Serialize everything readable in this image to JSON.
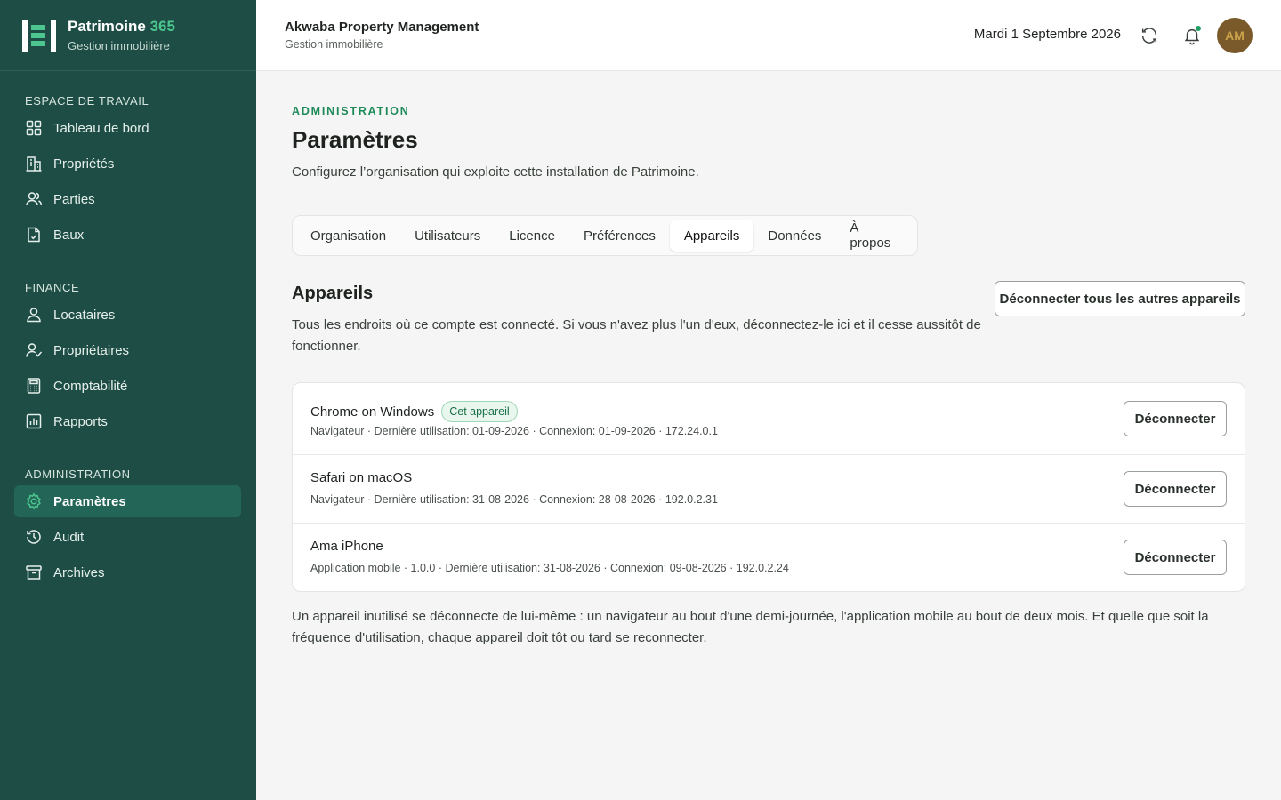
{
  "brand": {
    "name": "Patrimoine",
    "name_accent": "365",
    "subtitle": "Gestion immobilière"
  },
  "sidebar": {
    "sections": [
      {
        "heading": "ESPACE DE TRAVAIL",
        "items": [
          {
            "label": "Tableau de bord",
            "icon": "grid-icon"
          },
          {
            "label": "Propriétés",
            "icon": "building-icon"
          },
          {
            "label": "Parties",
            "icon": "users-icon"
          },
          {
            "label": "Baux",
            "icon": "document-icon"
          }
        ]
      },
      {
        "heading": "FINANCE",
        "items": [
          {
            "label": "Locataires",
            "icon": "user-group-icon"
          },
          {
            "label": "Propriétaires",
            "icon": "user-check-icon"
          },
          {
            "label": "Comptabilité",
            "icon": "calculator-icon"
          },
          {
            "label": "Rapports",
            "icon": "chart-icon"
          }
        ]
      },
      {
        "heading": "ADMINISTRATION",
        "items": [
          {
            "label": "Paramètres",
            "icon": "gear-icon",
            "active": true
          },
          {
            "label": "Audit",
            "icon": "history-icon"
          },
          {
            "label": "Archives",
            "icon": "archive-icon"
          }
        ]
      }
    ]
  },
  "header": {
    "org_name": "Akwaba Property Management",
    "org_subtitle": "Gestion immobilière",
    "date": "Mardi 1 Septembre 2026",
    "avatar_initials": "AM"
  },
  "page": {
    "eyebrow": "ADMINISTRATION",
    "title": "Paramètres",
    "description": "Configurez l’organisation qui exploite cette installation de Patrimoine.",
    "tabs": [
      "Organisation",
      "Utilisateurs",
      "Licence",
      "Préférences",
      "Appareils",
      "Données",
      "À propos"
    ],
    "active_tab": "Appareils"
  },
  "devices_section": {
    "title": "Appareils",
    "description": "Tous les endroits où ce compte est connecté. Si vous n'avez plus l'un d'eux, déconnectez-le ici et il cesse aussitôt de fonctionner.",
    "disconnect_all_label": "Déconnecter tous les autres appareils",
    "devices": [
      {
        "name": "Chrome on Windows",
        "badge": "Cet appareil",
        "meta": "Navigateur · Dernière utilisation: 01-09-2026 · Connexion: 01-09-2026 · 172.24.0.1",
        "action": "Déconnecter"
      },
      {
        "name": "Safari on macOS",
        "badge": "",
        "meta": "Navigateur · Dernière utilisation: 31-08-2026 · Connexion: 28-08-2026 · 192.0.2.31",
        "action": "Déconnecter"
      },
      {
        "name": "Ama iPhone",
        "badge": "",
        "meta": "Application mobile · 1.0.0 · Dernière utilisation: 31-08-2026 · Connexion: 09-08-2026 · 192.0.2.24",
        "action": "Déconnecter"
      }
    ],
    "footnote": "Un appareil inutilisé se déconnecte de lui-même : un navigateur au bout d'une demi-journée, l'application mobile au bout de deux mois. Et quelle que soit la fréquence d'utilisation, chaque appareil doit tôt ou tard se reconnecter."
  },
  "colors": {
    "sidebar_bg": "#1d4d44",
    "accent_green": "#1e8a5a",
    "brand_accent": "#4cc58e"
  }
}
